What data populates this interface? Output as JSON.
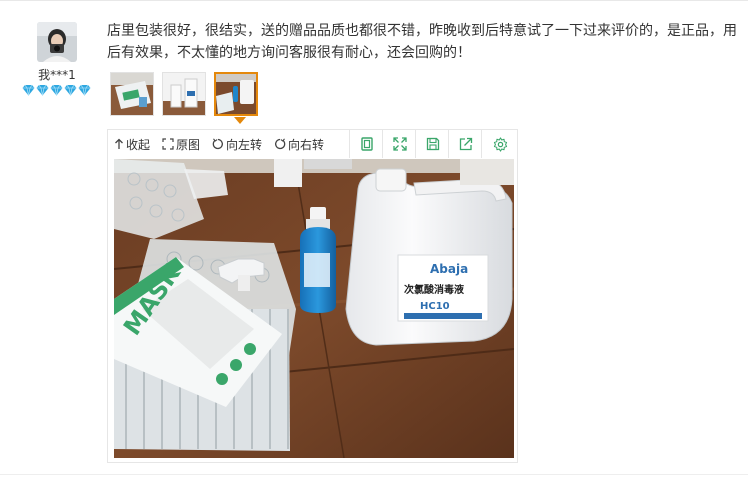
{
  "user": {
    "name": "我***1",
    "level_icons": [
      "diamond-icon",
      "diamond-icon",
      "diamond-icon",
      "diamond-icon",
      "diamond-icon"
    ]
  },
  "review": {
    "text": "店里包装很好，很结实，送的赠品品质也都很不错，昨晚收到后特意试了一下过来评价的，是正品，用后有效果，不太懂的地方询问客服很有耐心，还会回购的！"
  },
  "thumbnails": {
    "count": 3,
    "selected_index": 2
  },
  "toolbar": {
    "collapse_label": "收起",
    "original_label": "原图",
    "rotate_left_label": "向左转",
    "rotate_right_label": "向右转",
    "icons": [
      "fit-screen-icon",
      "fullscreen-icon",
      "save-icon",
      "share-icon",
      "settings-icon"
    ]
  },
  "photo": {
    "mask_brand_text": "MASK",
    "bottle_brand_text": "Abaja",
    "bottle_label_text": "次氯酸消毒液",
    "bottle_model_text": "HC10"
  },
  "colors": {
    "accent_orange": "#e4880b",
    "diamond_blue": "#2ea7e0",
    "icon_green": "#3aa66a"
  }
}
